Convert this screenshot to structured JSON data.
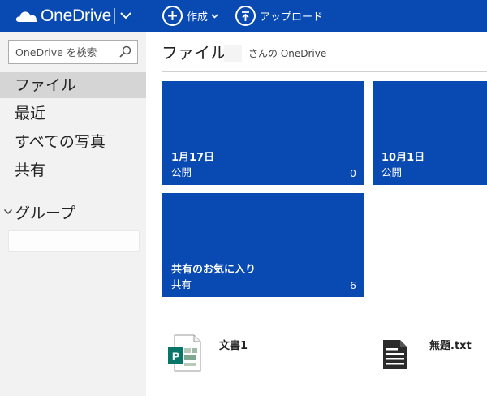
{
  "header": {
    "brand": "OneDrive",
    "create_label": "作成",
    "upload_label": "アップロード",
    "colors": {
      "bar": "#094ab2"
    }
  },
  "sidebar": {
    "search": {
      "placeholder": "OneDrive を検索",
      "value": ""
    },
    "items": [
      {
        "label": "ファイル",
        "active": true
      },
      {
        "label": "最近"
      },
      {
        "label": "すべての写真"
      },
      {
        "label": "共有"
      }
    ],
    "groups_label": "グループ"
  },
  "main": {
    "title": "ファイル",
    "owner_suffix": "さんの OneDrive",
    "folders": [
      {
        "name": "1月17日",
        "sharing": "公開",
        "count": "0"
      },
      {
        "name": "10月1日",
        "sharing": "公開",
        "count": ""
      },
      {
        "name": "共有のお気に入り",
        "sharing": "共有",
        "count": "6"
      }
    ],
    "files": [
      {
        "name": "文書1",
        "icon": "publisher-icon"
      },
      {
        "name": "無題.txt",
        "icon": "text-file-icon"
      }
    ]
  }
}
